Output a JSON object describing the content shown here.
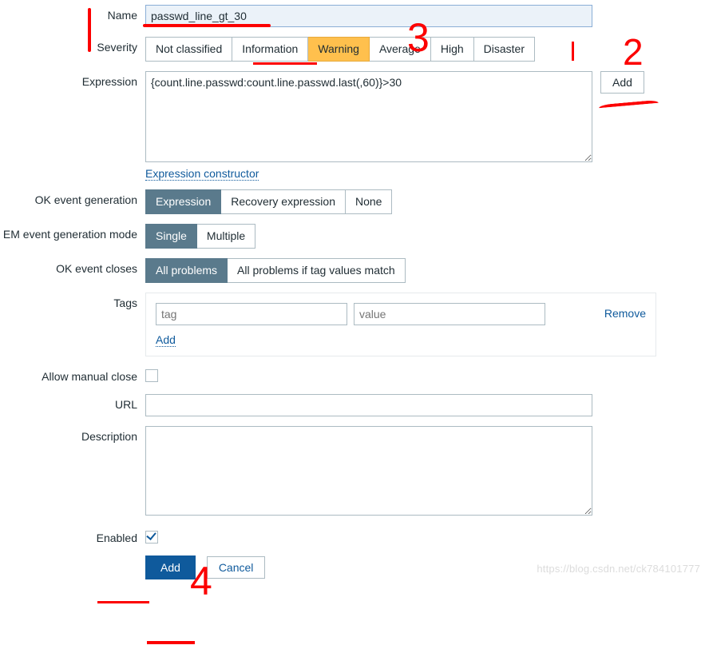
{
  "labels": {
    "name": "Name",
    "severity": "Severity",
    "expression": "Expression",
    "ok_event_generation": "OK event generation",
    "em_mode": "EM event generation mode",
    "ok_event_closes": "OK event closes",
    "tags": "Tags",
    "allow_manual_close": "Allow manual close",
    "url": "URL",
    "description": "Description",
    "enabled": "Enabled"
  },
  "values": {
    "name": "passwd_line_gt_30",
    "expression": "{count.line.passwd:count.line.passwd.last(,60)}>30",
    "url": "",
    "description": "",
    "enabled": true,
    "allow_manual_close": false,
    "tag": {
      "name": "",
      "value": ""
    }
  },
  "placeholders": {
    "tag": "tag",
    "value": "value"
  },
  "severity": {
    "options": [
      "Not classified",
      "Information",
      "Warning",
      "Average",
      "High",
      "Disaster"
    ],
    "selected": "Warning"
  },
  "ok_event_generation": {
    "options": [
      "Expression",
      "Recovery expression",
      "None"
    ],
    "selected": "Expression"
  },
  "em_mode": {
    "options": [
      "Single",
      "Multiple"
    ],
    "selected": "Single"
  },
  "ok_event_closes": {
    "options": [
      "All problems",
      "All problems if tag values match"
    ],
    "selected": "All problems"
  },
  "links": {
    "expression_constructor": "Expression constructor",
    "remove": "Remove",
    "add_tag": "Add"
  },
  "buttons": {
    "add_expr": "Add",
    "submit": "Add",
    "cancel": "Cancel"
  },
  "watermark": "https://blog.csdn.net/ck784101777"
}
